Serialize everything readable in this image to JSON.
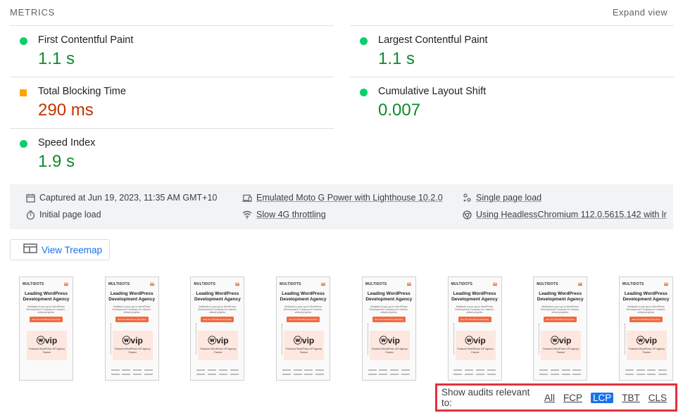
{
  "header": {
    "title": "METRICS",
    "expand_label": "Expand view"
  },
  "metrics": [
    {
      "label": "First Contentful Paint",
      "value": "1.1 s",
      "status": "pass"
    },
    {
      "label": "Largest Contentful Paint",
      "value": "1.1 s",
      "status": "pass"
    },
    {
      "label": "Total Blocking Time",
      "value": "290 ms",
      "status": "average"
    },
    {
      "label": "Cumulative Layout Shift",
      "value": "0.007",
      "status": "pass"
    },
    {
      "label": "Speed Index",
      "value": "1.9 s",
      "status": "pass"
    }
  ],
  "runtime": {
    "captured": "Captured at Jun 19, 2023, 11:35 AM GMT+10",
    "device": "Emulated Moto G Power with Lighthouse 10.2.0",
    "session": "Single page load",
    "load_type": "Initial page load",
    "throttling": "Slow 4G throttling",
    "browser": "Using HeadlessChromium 112.0.5615.142 with lr"
  },
  "treemap": {
    "label": "View Treemap"
  },
  "thumbnails": {
    "brand": "MULTIDOTS",
    "title_line1": "Leading WordPress",
    "title_line2": "Development Agency",
    "subtitle": "Multidots is your go-to WordPress Development Company for mission-critical projects.",
    "cta": "See Our WordPress Expertise",
    "vip": "ⓦvip",
    "vip_sub": "Featured WordPress VIP Agency Partner",
    "count": 8
  },
  "audit_filter": {
    "label": "Show audits relevant to:",
    "options": [
      "All",
      "FCP",
      "LCP",
      "TBT",
      "CLS"
    ],
    "active": "LCP"
  },
  "colors": {
    "pass": "#0cce6b",
    "average": "#ffa400",
    "link": "#1a73e8",
    "highlight": "#e0323c"
  }
}
